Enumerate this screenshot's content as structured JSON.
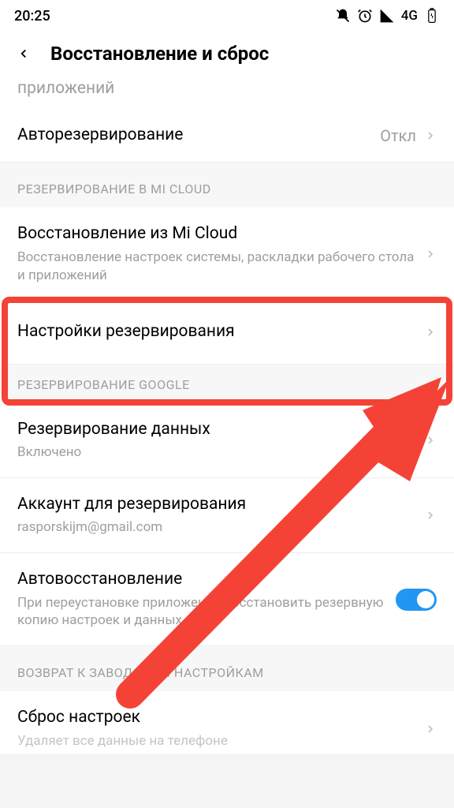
{
  "status": {
    "time": "20:25",
    "network": "4G"
  },
  "header": {
    "title": "Восстановление и сброс"
  },
  "cutTop": "приложений",
  "rows": {
    "autoBackup": {
      "title": "Авторезервирование",
      "value": "Откл"
    },
    "restoreCloud": {
      "title": "Восстановление из Mi Cloud",
      "sub": "Восстановление настроек системы, раскладки рабочего стола и приложений"
    },
    "backupSettings": {
      "title": "Настройки резервирования"
    },
    "dataBackup": {
      "title": "Резервирование данных",
      "sub": "Включено"
    },
    "backupAccount": {
      "title": "Аккаунт для резервирования",
      "sub": "rasporskijm@gmail.com"
    },
    "autoRestore": {
      "title": "Автовосстановление",
      "sub": "При переустановке приложения восстановить резервную копию настроек и данных"
    },
    "resetSettings": {
      "title": "Сброс настроек",
      "sub": "Удаляет все данные на телефоне"
    }
  },
  "sections": {
    "miCloud": "РЕЗЕРВИРОВАНИЕ В MI CLOUD",
    "google": "РЕЗЕРВИРОВАНИЕ GOOGLE",
    "factory": "ВОЗВРАТ К ЗАВОДСКИМ НАСТРОЙКАМ"
  },
  "annotation": {
    "highlight_color": "#f44336"
  }
}
